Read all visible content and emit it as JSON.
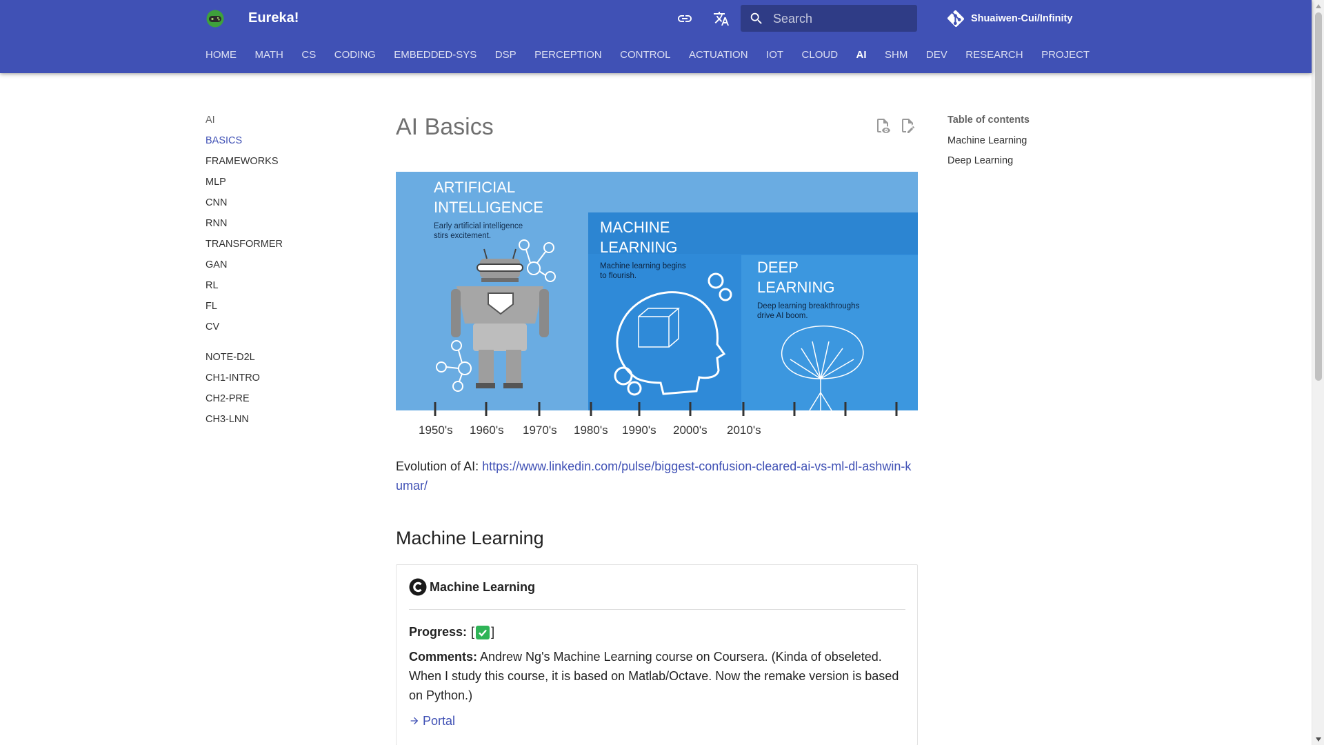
{
  "header": {
    "site_title": "Eureka!",
    "search_placeholder": "Search",
    "repo_name": "Shuaiwen-Cui/Infinity",
    "accent_color": "#4051b5",
    "icons": [
      "gamepad-logo",
      "link-icon",
      "translate-icon",
      "search-icon",
      "git-icon"
    ]
  },
  "tabs": [
    {
      "label": "HOME"
    },
    {
      "label": "MATH"
    },
    {
      "label": "CS"
    },
    {
      "label": "CODING"
    },
    {
      "label": "EMBEDDED-SYS"
    },
    {
      "label": "DSP"
    },
    {
      "label": "PERCEPTION"
    },
    {
      "label": "CONTROL"
    },
    {
      "label": "ACTUATION"
    },
    {
      "label": "IOT"
    },
    {
      "label": "CLOUD"
    },
    {
      "label": "AI"
    },
    {
      "label": "SHM"
    },
    {
      "label": "DEV"
    },
    {
      "label": "RESEARCH"
    },
    {
      "label": "PROJECT"
    }
  ],
  "active_tab": "AI",
  "sidebar": {
    "section_title": "AI",
    "items": [
      {
        "label": "BASICS"
      },
      {
        "label": "FRAMEWORKS"
      },
      {
        "label": "MLP"
      },
      {
        "label": "CNN"
      },
      {
        "label": "RNN"
      },
      {
        "label": "TRANSFORMER"
      },
      {
        "label": "GAN"
      },
      {
        "label": "RL"
      },
      {
        "label": "FL"
      },
      {
        "label": "CV"
      }
    ],
    "active_item": "BASICS",
    "section2_title": "NOTE-D2L",
    "items2": [
      {
        "label": "CH1-INTRO"
      },
      {
        "label": "CH2-PRE"
      },
      {
        "label": "CH3-LNN"
      }
    ]
  },
  "page": {
    "title": "AI Basics",
    "figure": {
      "ai_title_1": "ARTIFICIAL",
      "ai_title_2": "INTELLIGENCE",
      "ai_sub_1": "Early artificial intelligence",
      "ai_sub_2": "stirs excitement.",
      "ml_title_1": "MACHINE",
      "ml_title_2": "LEARNING",
      "ml_sub_1": "Machine learning begins",
      "ml_sub_2": "to flourish.",
      "dl_title_1": "DEEP",
      "dl_title_2": "LEARNING",
      "dl_sub_1": "Deep learning breakthroughs",
      "dl_sub_2": "drive AI boom.",
      "years": [
        "1950's",
        "1960's",
        "1970's",
        "1980's",
        "1990's",
        "2000's",
        "2010's"
      ]
    },
    "caption_prefix": "Evolution of AI: ",
    "caption_link": "https://www.linkedin.com/pulse/biggest-confusion-cleared-ai-vs-ml-dl-ashwin-kumar/",
    "section_heading": "Machine Learning",
    "card": {
      "title": "Machine Learning",
      "progress_label": "Progress:",
      "bracket_open": "[",
      "bracket_close": "]",
      "comments_label": "Comments:",
      "comments_text": " Andrew Ng's Machine Learning course on Coursera. (Kinda of obseleted. When I study this course, it is based on Matlab/Octave. Now the remake version is based on Python.)",
      "portal_label": "Portal"
    }
  },
  "toc": {
    "title": "Table of contents",
    "items": [
      {
        "label": "Machine Learning"
      },
      {
        "label": "Deep Learning"
      }
    ]
  }
}
